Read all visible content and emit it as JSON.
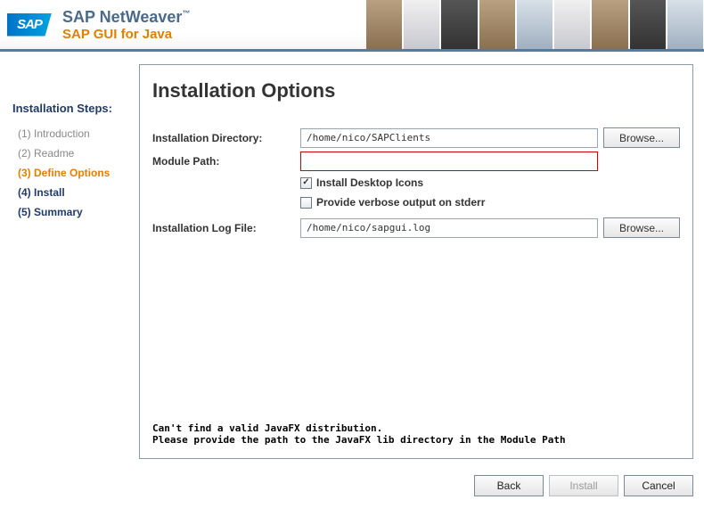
{
  "header": {
    "logo": "SAP",
    "title": "SAP NetWeaver",
    "tm": "™",
    "subtitle": "SAP GUI for Java"
  },
  "sidebar": {
    "title": "Installation Steps:",
    "steps": [
      {
        "label": "(1) Introduction",
        "state": "done"
      },
      {
        "label": "(2) Readme",
        "state": "done"
      },
      {
        "label": "(3) Define Options",
        "state": "active"
      },
      {
        "label": "(4) Install",
        "state": "pending"
      },
      {
        "label": "(5) Summary",
        "state": "pending"
      }
    ]
  },
  "main": {
    "title": "Installation Options",
    "fields": {
      "install_dir": {
        "label": "Installation Directory:",
        "value": "/home/nico/SAPClients",
        "browse": "Browse..."
      },
      "module_path": {
        "label": "Module Path:",
        "value": ""
      },
      "desktop_icons": {
        "label": "Install Desktop Icons",
        "checked": true
      },
      "verbose": {
        "label": "Provide verbose output on stderr",
        "checked": false
      },
      "log_file": {
        "label": "Installation Log File:",
        "value": "/home/nico/sapgui.log",
        "browse": "Browse..."
      }
    },
    "error": "Can't find a valid JavaFX distribution.\nPlease provide the path to the JavaFX lib directory in the Module Path"
  },
  "footer": {
    "back": "Back",
    "install": "Install",
    "cancel": "Cancel"
  }
}
